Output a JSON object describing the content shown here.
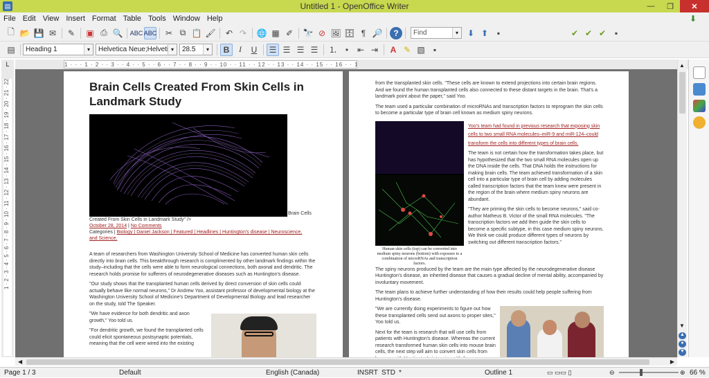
{
  "window": {
    "title": "Untitled 1 - OpenOffice Writer"
  },
  "menu": [
    "File",
    "Edit",
    "View",
    "Insert",
    "Format",
    "Table",
    "Tools",
    "Window",
    "Help"
  ],
  "toolbar": {
    "find_placeholder": "Find",
    "paragraph_style": "Heading 1",
    "font_name": "Helvetica Neue;Helvetica",
    "font_size": "28.5"
  },
  "ruler": {
    "marks": "1 · · · 1 · 2 · · 3 · · 4 · · 5 · · 6 · · 7 · · 8 · · 9 · · 10 · · 11 · · 12 · · 13 · · 14 · · 15 · · 16 · · 17 · · 18 · 19"
  },
  "vruler": {
    "marks": "1 · 2 · 3 · 4 · 5 · 6 · 7 · 8 · 9 · 10 · 11 · 12 · 13 · 14 · 15 · 16 · 17 · 18 · 19 · 20 · 21 · 22"
  },
  "page1": {
    "headline": "Brain Cells Created From Skin Cells in Landmark Study",
    "img_alt_tail": "Brain Cells",
    "img_alt_line2": "Created From Skin Cells in Landmark Study\" />",
    "date": "October 28, 2014",
    "comments": "No Comments",
    "categories_label": "Categories",
    "categories": "Biology | Daniel Jackson | Featured | Headlines | Huntington's disease | Neuroscience,",
    "categories_end": "and Science.",
    "p1": "A team of researchers from Washington University School of Medicine has converted human skin cells directly into brain cells. This breakthrough research is complimented by other landmark findings within the study–including that the cells were able to form neurological connections, both axonal and dendritic. The research holds promise for sufferers of neurodegenerative diseases such as Huntington's disease.",
    "p2": "\"Our study shows that the transplanted human cells derived by direct conversion of skin cells could actually behave like normal neurons,\" Dr Andrew Yoo, assistant professor of developmental biology at the Washington University School of Medicine's Department of Developmental Biology and lead researcher on the study, told The Speaker.",
    "p3": "\"We have evidence for both dendritic and axon growth,\" Yoo told us.",
    "p4": "\"For dendritic growth, we found the transplanted cells could elicit spontaneous postsynaptic potentials, meaning that the cell were wired into the existing"
  },
  "page2": {
    "p0": "from the transplanted skin cells. \"These cells are known to extend projections into certain brain regions. And we found the human transplanted cells also connected to these distant targets in the brain. That's a landmark point about the paper,\" said Yoo.",
    "p1": "The team used a particular combination of microRNAs and transcription factors to reprogram the skin cells to become a particular type of brain cell known as medium spiny neurons.",
    "p2": "Yoo's team had found in previous research that exposing skin cells to two small RNA molecules–miR-9 and miR-124–could transform the cells into different types of brain cells.",
    "p3": "The team is not certain how the transformation takes place, but has hypothesized that the two small RNA molecules open up the DNA inside the cells. That DNA holds the instructions for making brain cells. The team achieved transformation of a skin cell into a particular type of brain cell by adding molecules called transcription factors that the team knew were present in the region of the brain where medium spiny neurons are abundant.",
    "p4": "\"They are priming the skin cells to become neurons,\" said co-author Matheus B. Victor of the small RNA molecules. \"The transcription factors we add then guide the skin cells to become a specific subtype, in this case medium spiny neurons. We think we could produce different types of neurons by switching out different transcription factors.\"",
    "caption": "Human skin cells (top) can be converted into medium spiny neurons (bottom) with exposure to a combination of microRNAs and transcription factors.",
    "p5": "The spiny neurons produced by the team are the main type affected by the neurodegenerative disease Huntington's disease, an inherited disease that causes a gradual decline of mental ability, accompanied by involuntary movement.",
    "p6": "The team plans to achieve further understanding of how their results could help people suffering from Huntington's disease.",
    "p7": "\"We are currently doing experiments to figure out how these transplanted cells send out axons to proper sites,\" Yoo told us.",
    "p8": "Next for the team is research that will use cells from patients with Huntington's disease. Whereas the current research transformed human skin cells into mouse brain cells, the next step will aim to convert skin cells from humans with Huntington's into mice with the same disease, again trying to create medium spiny neurons."
  },
  "status": {
    "page": "Page 1 / 3",
    "style": "Default",
    "language": "English (Canada)",
    "insert": "INSRT",
    "selection": "STD",
    "modified": "*",
    "outline": "Outline 1",
    "zoom": "66 %"
  },
  "colors": {
    "titlebar": "#c8d84f",
    "link": "#a22020",
    "workspace": "#707070"
  }
}
